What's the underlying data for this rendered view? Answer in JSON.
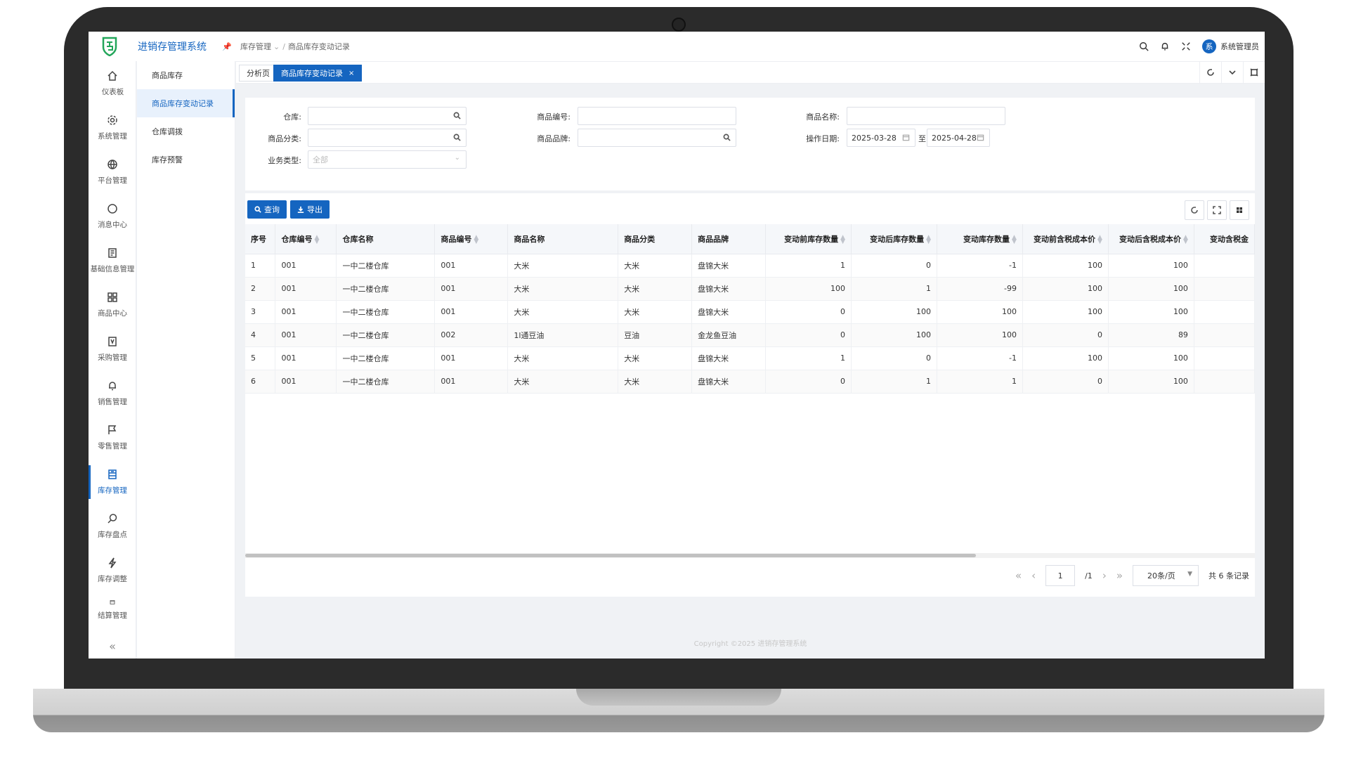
{
  "app": {
    "title": "进销存管理系统"
  },
  "breadcrumb": {
    "parent": "库存管理",
    "current": "商品库存变动记录"
  },
  "user": {
    "avatar_text": "系",
    "name": "系统管理员"
  },
  "nav": {
    "items": [
      {
        "label": "仪表板",
        "icon": "home-icon"
      },
      {
        "label": "系统管理",
        "icon": "gear-icon"
      },
      {
        "label": "平台管理",
        "icon": "globe-icon"
      },
      {
        "label": "消息中心",
        "icon": "chat-icon"
      },
      {
        "label": "基础信息管理",
        "icon": "document-icon"
      },
      {
        "label": "商品中心",
        "icon": "grid-icon"
      },
      {
        "label": "采购管理",
        "icon": "purchase-icon"
      },
      {
        "label": "销售管理",
        "icon": "bell-icon"
      },
      {
        "label": "零售管理",
        "icon": "flag-icon"
      },
      {
        "label": "库存管理",
        "icon": "inventory-icon"
      },
      {
        "label": "库存盘点",
        "icon": "magnify-icon"
      },
      {
        "label": "库存调整",
        "icon": "lightning-icon"
      },
      {
        "label": "结算管理",
        "icon": "card-icon"
      }
    ],
    "collapse": "«"
  },
  "subnav": {
    "items": [
      "商品库存",
      "商品库存变动记录",
      "仓库调拨",
      "库存预警"
    ]
  },
  "tabs": {
    "items": [
      "分析页",
      "商品库存变动记录"
    ],
    "close": "×"
  },
  "filters": {
    "warehouse_label": "仓库:",
    "product_code_label": "商品编号:",
    "product_name_label": "商品名称:",
    "category_label": "商品分类:",
    "brand_label": "商品品牌:",
    "date_label": "操作日期:",
    "date_start": "2025-03-28",
    "date_sep": "至",
    "date_end": "2025-04-28",
    "biz_type_label": "业务类型:",
    "biz_type_value": "全部"
  },
  "actions": {
    "query": "查询",
    "export": "导出"
  },
  "table": {
    "columns": [
      "序号",
      "仓库编号",
      "仓库名称",
      "商品编号",
      "商品名称",
      "商品分类",
      "商品品牌",
      "变动前库存数量",
      "变动后库存数量",
      "变动库存数量",
      "变动前含税成本价",
      "变动后含税成本价",
      "变动含税金"
    ],
    "rows": [
      [
        "1",
        "001",
        "一中二楼仓库",
        "001",
        "大米",
        "大米",
        "盘锦大米",
        "1",
        "0",
        "-1",
        "100",
        "100",
        ""
      ],
      [
        "2",
        "001",
        "一中二楼仓库",
        "001",
        "大米",
        "大米",
        "盘锦大米",
        "100",
        "1",
        "-99",
        "100",
        "100",
        ""
      ],
      [
        "3",
        "001",
        "一中二楼仓库",
        "001",
        "大米",
        "大米",
        "盘锦大米",
        "0",
        "100",
        "100",
        "100",
        "100",
        ""
      ],
      [
        "4",
        "001",
        "一中二楼仓库",
        "002",
        "1l通豆油",
        "豆油",
        "金龙鱼豆油",
        "0",
        "100",
        "100",
        "0",
        "89",
        ""
      ],
      [
        "5",
        "001",
        "一中二楼仓库",
        "001",
        "大米",
        "大米",
        "盘锦大米",
        "1",
        "0",
        "-1",
        "100",
        "100",
        ""
      ],
      [
        "6",
        "001",
        "一中二楼仓库",
        "001",
        "大米",
        "大米",
        "盘锦大米",
        "0",
        "1",
        "1",
        "0",
        "100",
        ""
      ]
    ]
  },
  "pagination": {
    "current": "1",
    "total_pages": "/1",
    "page_size": "20条/页",
    "summary": "共 6 条记录"
  },
  "footer": {
    "copyright": "Copyright ©2025 进销存管理系统"
  },
  "colors": {
    "primary": "#1565c0"
  }
}
